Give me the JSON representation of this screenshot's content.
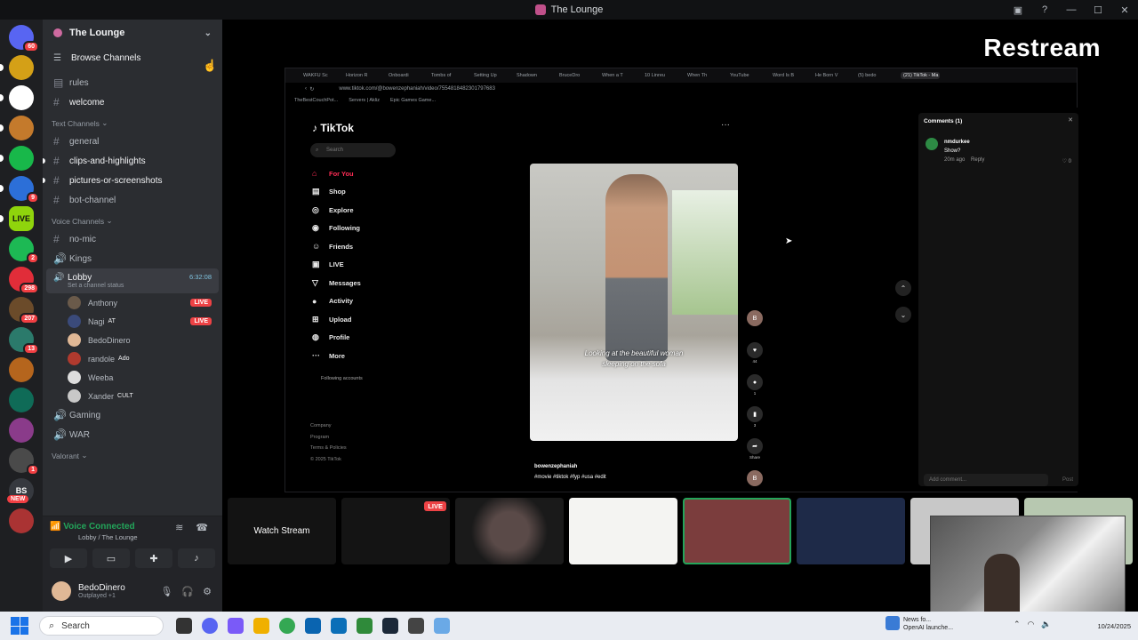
{
  "window": {
    "title": "The Lounge"
  },
  "rail": {
    "servers": [
      {
        "name": "discord-home",
        "color": "#5865f2",
        "badge": "60",
        "label": ""
      },
      {
        "name": "server-2",
        "color": "#d4a017",
        "badge": "",
        "label": ""
      },
      {
        "name": "server-3",
        "color": "#ffffff",
        "badge": "",
        "label": ""
      },
      {
        "name": "server-4",
        "color": "#c47a2c",
        "badge": "",
        "label": ""
      },
      {
        "name": "server-5",
        "color": "#18b84a",
        "badge": "",
        "label": ""
      },
      {
        "name": "server-6",
        "color": "#2c6fd8",
        "badge": "9",
        "label": ""
      },
      {
        "name": "server-7",
        "color": "#8fd40c",
        "badge": "",
        "label": "LIVE"
      },
      {
        "name": "server-8",
        "color": "#1db954",
        "badge": "2",
        "label": ""
      },
      {
        "name": "server-9",
        "color": "#e12d39",
        "badge": "298",
        "label": ""
      },
      {
        "name": "server-10",
        "color": "#6b4b2a",
        "badge": "207",
        "label": ""
      },
      {
        "name": "server-11",
        "color": "#2b7a6b",
        "badge": "13",
        "label": ""
      },
      {
        "name": "server-12",
        "color": "#b5651d",
        "badge": "",
        "label": ""
      },
      {
        "name": "server-13",
        "color": "#0f6b57",
        "badge": "",
        "label": ""
      },
      {
        "name": "server-14",
        "color": "#8a3b8a",
        "badge": "",
        "label": ""
      },
      {
        "name": "server-15",
        "color": "#4a4a4a",
        "badge": "1",
        "label": ""
      },
      {
        "name": "server-16",
        "color": "#36393f",
        "badge": "",
        "label": "BS"
      },
      {
        "name": "server-17",
        "color": "#a33",
        "badge": "",
        "label": ""
      }
    ],
    "new_badge": "NEW"
  },
  "sidebar": {
    "server_name": "The Lounge",
    "browse_channels": "Browse Channels",
    "channels_top": [
      {
        "name": "rules",
        "icon": "rules-icon"
      },
      {
        "name": "welcome",
        "icon": "hash-icon"
      }
    ],
    "text_category": "Text Channels",
    "text_channels": [
      {
        "name": "general"
      },
      {
        "name": "clips-and-highlights"
      },
      {
        "name": "pictures-or-screenshots"
      },
      {
        "name": "bot-channel"
      }
    ],
    "voice_category": "Voice Channels",
    "voice_channels_top": [
      {
        "name": "no-mic"
      },
      {
        "name": "Kings"
      }
    ],
    "lobby": {
      "name": "Lobby",
      "timer": "6:32:08",
      "status": "Set a channel status"
    },
    "lobby_users": [
      {
        "name": "Anthony",
        "live": "LIVE",
        "tag": "",
        "color": "#6a5a4a"
      },
      {
        "name": "Nagi",
        "live": "LIVE",
        "tag": "AT",
        "color": "#3a4a7a"
      },
      {
        "name": "BedoDinero",
        "live": "",
        "tag": "",
        "color": "#e0b896"
      },
      {
        "name": "randole",
        "live": "",
        "tag": "Ado",
        "color": "#b03a2e"
      },
      {
        "name": "Weeba",
        "live": "",
        "tag": "",
        "color": "#ddd"
      },
      {
        "name": "Xander",
        "live": "",
        "tag": "CULT",
        "color": "#c8c8c8"
      }
    ],
    "voice_channels_bottom": [
      {
        "name": "Gaming"
      },
      {
        "name": "WAR"
      }
    ],
    "valorant_category": "Valorant"
  },
  "voice": {
    "status": "Voice Connected",
    "location": "Lobby / The Lounge"
  },
  "user": {
    "name": "BedoDinero",
    "sub": "Outplayed +1"
  },
  "stage": {
    "overlay_text": "Restream"
  },
  "browser": {
    "tabs": [
      "WAKFU Sc",
      "Horizon R",
      "Onboardi",
      "Tombs of",
      "Setting Up",
      "Shadown",
      "BruceDro",
      "When a T",
      "10 Linreu",
      "When Th",
      "YouTube",
      "Word Is B",
      "He Born V",
      "(5) bedo",
      "(21) TikTok - Ma"
    ],
    "url": "www.tiktok.com/@bowenzephaniah/video/7554818482301797683",
    "bookmarks": [
      "TheBestCouchPot...",
      "Servers | Akliz",
      "Epic Games Game..."
    ]
  },
  "tiktok": {
    "logo": "TikTok",
    "search_placeholder": "Search",
    "nav": [
      {
        "label": "For You",
        "icon": "home-icon"
      },
      {
        "label": "Shop",
        "icon": "shop-icon"
      },
      {
        "label": "Explore",
        "icon": "compass-icon"
      },
      {
        "label": "Following",
        "icon": "following-icon"
      },
      {
        "label": "Friends",
        "icon": "friends-icon"
      },
      {
        "label": "LIVE",
        "icon": "live-icon"
      },
      {
        "label": "Messages",
        "icon": "messages-icon"
      },
      {
        "label": "Activity",
        "icon": "activity-icon"
      },
      {
        "label": "Upload",
        "icon": "upload-icon"
      },
      {
        "label": "Profile",
        "icon": "profile-icon"
      },
      {
        "label": "More",
        "icon": "more-icon"
      }
    ],
    "following_accounts": "Following accounts",
    "footer": [
      "Company",
      "Program",
      "Terms & Policies",
      "© 2025 TikTok"
    ],
    "caption_line1": "Looking at the beautiful woman",
    "caption_line2": "sleeping on the sofa",
    "author": "bowenzephaniah",
    "hashtags": "#movie #tiktok #fyp #usa #edit",
    "likes": "44",
    "comments_count": "1",
    "saves": "3",
    "share": "Share",
    "avatar_letter": "B"
  },
  "comments_panel": {
    "header": "Comments (1)",
    "author": "nmdurkee",
    "text": "Show?",
    "time": "20m ago",
    "reply": "Reply",
    "likes": "0",
    "add_placeholder": "Add comment...",
    "post": "Post"
  },
  "tiles": {
    "watch_label": "Watch Stream",
    "live_label": "LIVE"
  },
  "taskbar": {
    "search": "Search",
    "news_line1": "News fo...",
    "news_line2": "OpenAI launche...",
    "date": "10/24/2025"
  }
}
